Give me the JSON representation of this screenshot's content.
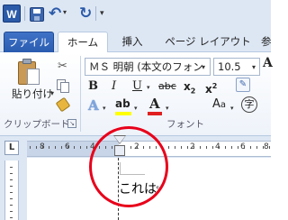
{
  "quick_access": {
    "app_icon_letter": "W",
    "more_arrow": "▾"
  },
  "tabs": {
    "file": "ファイル",
    "home": "ホーム",
    "insert": "挿入",
    "page_layout": "ページ レイアウト",
    "more": "参"
  },
  "clipboard": {
    "paste_label": "貼り付け",
    "group_label": "クリップボード"
  },
  "font": {
    "font_name": "ＭＳ 明朝 (本文のフォン",
    "font_size": "10.5",
    "group_label": "フォント",
    "bold": "B",
    "italic": "I",
    "underline": "U",
    "strikethrough": "abc",
    "subscript_base": "x",
    "subscript": "2",
    "superscript_base": "x",
    "superscript": "2",
    "effects": "A",
    "highlight": "ab",
    "font_color": "A",
    "change_case_big": "A",
    "change_case_small": "a",
    "enclose": "字",
    "grow": "A"
  },
  "colors": {
    "highlight": "#ffff00",
    "font_color": "#e02020",
    "circle": "#e8001a"
  },
  "ruler": {
    "tab_selector": "L",
    "numbers": [
      "8",
      "6",
      "4",
      "2",
      "2",
      "4",
      "6",
      "8"
    ]
  },
  "document": {
    "text": "これは",
    "return_mark": "↵"
  }
}
